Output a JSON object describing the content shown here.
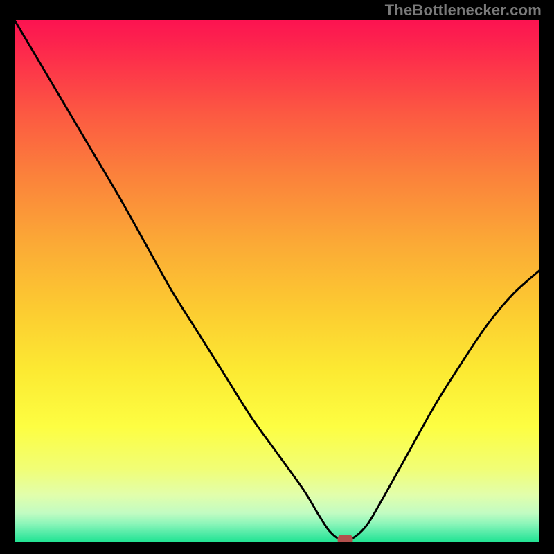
{
  "attribution": "TheBottlenecker.com",
  "chart_data": {
    "type": "line",
    "title": "",
    "xlabel": "",
    "ylabel": "",
    "xlim": [
      0,
      100
    ],
    "ylim": [
      0,
      100
    ],
    "series": [
      {
        "name": "bottleneck-curve",
        "x": [
          0.0,
          5.0,
          10.0,
          15.0,
          20.0,
          25.0,
          30.0,
          35.0,
          40.0,
          45.0,
          50.0,
          55.0,
          58.0,
          60.0,
          62.0,
          64.0,
          67.0,
          70.0,
          75.0,
          80.0,
          85.0,
          90.0,
          95.0,
          100.0
        ],
        "y": [
          100.0,
          91.5,
          83.0,
          74.5,
          66.0,
          57.0,
          48.0,
          40.0,
          32.0,
          24.0,
          17.0,
          10.0,
          5.0,
          2.0,
          0.4,
          0.4,
          3.0,
          8.0,
          17.0,
          26.0,
          34.0,
          41.5,
          47.5,
          52.0
        ]
      }
    ],
    "marker": {
      "x": 63.0,
      "y": 0.4,
      "color": "#b1504d"
    },
    "background_gradient": {
      "stops": [
        {
          "offset": 0.0,
          "color": "#fc1351"
        },
        {
          "offset": 0.07,
          "color": "#fd2d4b"
        },
        {
          "offset": 0.18,
          "color": "#fc5942"
        },
        {
          "offset": 0.3,
          "color": "#fb823b"
        },
        {
          "offset": 0.43,
          "color": "#fbaa36"
        },
        {
          "offset": 0.55,
          "color": "#fcca31"
        },
        {
          "offset": 0.67,
          "color": "#fce932"
        },
        {
          "offset": 0.78,
          "color": "#fdfe42"
        },
        {
          "offset": 0.86,
          "color": "#f1fe75"
        },
        {
          "offset": 0.91,
          "color": "#e2feab"
        },
        {
          "offset": 0.945,
          "color": "#c2fcc2"
        },
        {
          "offset": 0.965,
          "color": "#8ef6ba"
        },
        {
          "offset": 0.985,
          "color": "#4feba6"
        },
        {
          "offset": 1.0,
          "color": "#23e494"
        }
      ]
    }
  }
}
